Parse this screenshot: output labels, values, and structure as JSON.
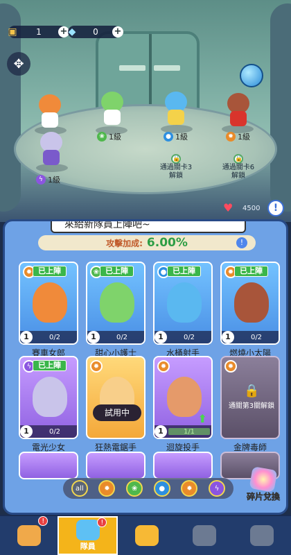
{
  "header": {
    "resource1": {
      "icon": "ticket-icon",
      "value": "1"
    },
    "resource2": {
      "icon": "crystal-icon",
      "value": "0"
    }
  },
  "stage": {
    "heroes": [
      {
        "name": "賽車女郎",
        "level": "1級",
        "element": "fire",
        "color": "#f08a3a"
      },
      {
        "name": "甜心小護士",
        "level": "1級",
        "element": "grass",
        "color": "#7fd36b"
      },
      {
        "name": "水桶射手",
        "level": "1級",
        "element": "water",
        "color": "#5ab8f0"
      },
      {
        "name": "燃燒小太陽",
        "level": "1級",
        "element": "fire",
        "color": "#a8553a"
      },
      {
        "name": "電光少女",
        "level": "1級",
        "element": "electric",
        "color": "#c9c4ea"
      }
    ],
    "locked_slots": [
      {
        "text": "通過關卡3\n解鎖"
      },
      {
        "text": "通過關卡6\n解鎖"
      }
    ],
    "hp": "4500"
  },
  "panel": {
    "speech": "來給新隊員上陣吧~",
    "bonus_label": "攻擊加成:",
    "bonus_value": "6.00%",
    "deployed_label": "已上陣",
    "cards": [
      {
        "name": "賽車女郎",
        "level": "1",
        "fragments": "0/2",
        "fill": 0,
        "style": "blue",
        "element": "fire",
        "deployed": true
      },
      {
        "name": "甜心小護士",
        "level": "1",
        "fragments": "0/2",
        "fill": 0,
        "style": "blue",
        "element": "grass",
        "deployed": true
      },
      {
        "name": "水桶射手",
        "level": "1",
        "fragments": "0/2",
        "fill": 0,
        "style": "blue",
        "element": "water",
        "deployed": true
      },
      {
        "name": "燃燒小太陽",
        "level": "1",
        "fragments": "0/2",
        "fill": 0,
        "style": "blue",
        "element": "fire",
        "deployed": true
      },
      {
        "name": "電光少女",
        "level": "1",
        "fragments": "0/2",
        "fill": 0,
        "style": "purple",
        "element": "electric",
        "deployed": true
      },
      {
        "name": "狂熱電鋸手",
        "level": "",
        "fragments": "",
        "fill": 0,
        "style": "gold",
        "element": "fire",
        "trial": "試用中"
      },
      {
        "name": "迴旋投手",
        "level": "1",
        "fragments": "1/1",
        "fill": 1,
        "style": "purple",
        "element": "fire",
        "upgradable": true
      },
      {
        "name": "金牌毒師",
        "level": "",
        "fragments": "",
        "fill": 0,
        "style": "locked",
        "element": "fire",
        "lock_text": "通關第3關解鎖"
      }
    ],
    "filters": [
      "all",
      "fire",
      "grass",
      "water",
      "fire",
      "electric"
    ],
    "exchange_label": "碎片兌換"
  },
  "navbar": [
    {
      "label": "",
      "icon": "shop-icon",
      "alert": "!"
    },
    {
      "label": "隊員",
      "icon": "team-icon",
      "alert": "!",
      "active": true
    },
    {
      "label": "",
      "icon": "battle-icon",
      "alert": ""
    },
    {
      "label": "",
      "icon": "locked-helmet-icon",
      "alert": ""
    },
    {
      "label": "",
      "icon": "locked-book-icon",
      "alert": ""
    }
  ],
  "colors": {
    "fire": "#e98b2a",
    "grass": "#4fb84c",
    "water": "#2d8fe0",
    "electric": "#8b55e0"
  }
}
